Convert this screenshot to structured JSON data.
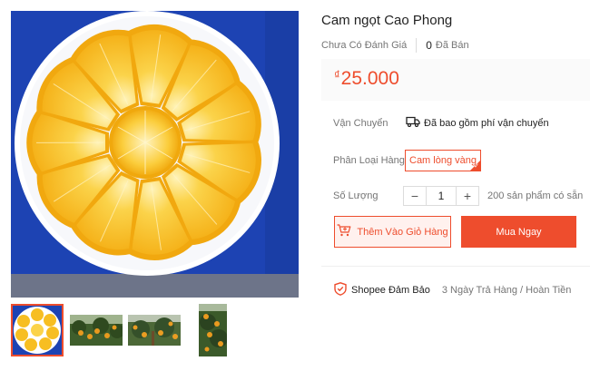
{
  "product": {
    "title": "Cam ngọt Cao Phong",
    "rating_text": "Chưa Có Đánh Giá",
    "sold_count": "0",
    "sold_label": "Đã Bán",
    "currency_symbol": "₫",
    "price": "25.000"
  },
  "shipping": {
    "label": "Vận Chuyển",
    "value": "Đã bao gồm phí vận chuyển",
    "icon": "truck-icon"
  },
  "variant": {
    "label": "Phân Loại Hàng",
    "options": [
      "Cam lòng vàng"
    ],
    "selected": "Cam lòng vàng"
  },
  "quantity": {
    "label": "Số Lượng",
    "value": "1",
    "decrement": "−",
    "increment": "+",
    "stock_text": "200 sản phẩm có sẵn"
  },
  "actions": {
    "add_to_cart": "Thêm Vào Giỏ Hàng",
    "buy_now": "Mua Ngay"
  },
  "guarantee": {
    "label": "Shopee Đảm Bảo",
    "policy": "3 Ngày Trả Hàng / Hoàn Tiền",
    "icon": "shield-icon"
  },
  "gallery": {
    "thumbnails": [
      "orange-slices",
      "orange-tree",
      "orange-orchard",
      "orange-tree-tall"
    ],
    "active_index": 0
  },
  "colors": {
    "accent": "#ee4d2d",
    "accent_light": "#fff1ee",
    "plate": "#ffffff",
    "tray": "#1f46b8",
    "orange_peel": "#f2b410",
    "orange_flesh": "#fbc52c"
  }
}
